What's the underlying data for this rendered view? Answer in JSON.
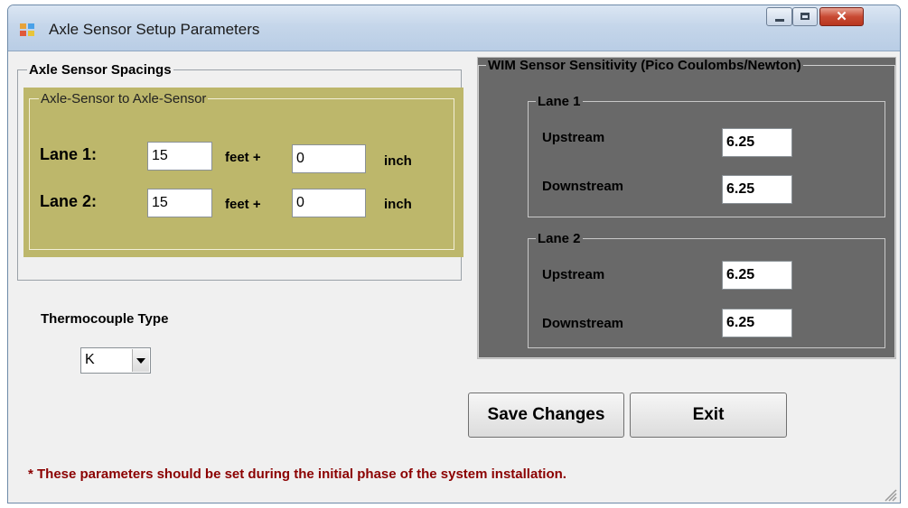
{
  "window": {
    "title": "Axle Sensor Setup Parameters"
  },
  "colors": {
    "olive_panel": "#bdb76b",
    "dark_panel": "#696969",
    "note_red": "#8b0000"
  },
  "axle": {
    "group_title": "Axle Sensor Spacings",
    "inner_title": "Axle-Sensor to Axle-Sensor",
    "lanes": [
      {
        "label": "Lane 1:",
        "feet": "15",
        "feet_label": "feet +",
        "inch": "0",
        "inch_label": "inch"
      },
      {
        "label": "Lane 2:",
        "feet": "15",
        "feet_label": "feet +",
        "inch": "0",
        "inch_label": "inch"
      }
    ]
  },
  "thermo": {
    "label": "Thermocouple Type",
    "value": "K"
  },
  "wim": {
    "title": "WIM Sensor Sensitivity (Pico Coulombs/Newton)",
    "lanes": [
      {
        "title": "Lane 1",
        "upstream_label": "Upstream",
        "upstream": "6.25",
        "downstream_label": "Downstream",
        "downstream": "6.25"
      },
      {
        "title": "Lane 2",
        "upstream_label": "Upstream",
        "upstream": "6.25",
        "downstream_label": "Downstream",
        "downstream": "6.25"
      }
    ]
  },
  "buttons": {
    "save": "Save Changes",
    "exit": "Exit"
  },
  "note": "* These parameters should be set during the initial phase of the system installation."
}
